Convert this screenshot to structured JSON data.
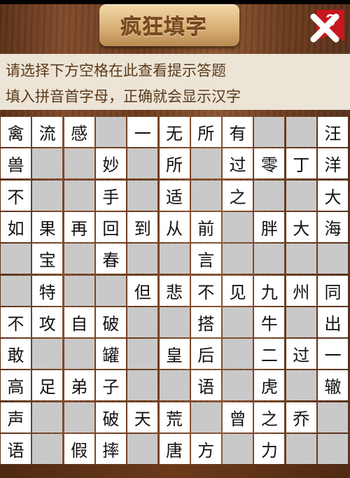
{
  "header": {
    "title": "疯狂填字",
    "level": "3",
    "close_icon": "close-x-icon"
  },
  "hint_panel": {
    "line1": "请选择下方空格在此查看提示答题",
    "line2": "填入拼音首字母，正确就会显示汉字"
  },
  "colors": {
    "background_wood": "#6b3d1c",
    "hint_panel": "#ece4d6",
    "hint_text": "#5a3a1c",
    "cell_letter": "#ffffff",
    "cell_blank": "#c9c9c9",
    "ribbon": "#c8161e"
  },
  "grid": {
    "rows": 11,
    "cols": 11,
    "cells": [
      [
        "禽",
        "流",
        "感",
        "#",
        "一",
        "无",
        "所",
        "有",
        "#",
        "#",
        "汪"
      ],
      [
        "兽",
        "#",
        "#",
        "妙",
        "#",
        "所",
        "#",
        "过",
        "零",
        "丁",
        "洋"
      ],
      [
        "不",
        "#",
        "#",
        "手",
        "#",
        "适",
        "#",
        "之",
        "#",
        "#",
        "大"
      ],
      [
        "如",
        "果",
        "再",
        "回",
        "到",
        "从",
        "前",
        "#",
        "胖",
        "大",
        "海"
      ],
      [
        "#",
        "宝",
        "#",
        "春",
        "#",
        "#",
        "言",
        "#",
        "#",
        "#",
        "#"
      ],
      [
        "#",
        "特",
        "#",
        "#",
        "但",
        "悲",
        "不",
        "见",
        "九",
        "州",
        "同"
      ],
      [
        "不",
        "攻",
        "自",
        "破",
        "#",
        "#",
        "搭",
        "#",
        "牛",
        "#",
        "出"
      ],
      [
        "敢",
        "#",
        "#",
        "罐",
        "#",
        "皇",
        "后",
        "#",
        "二",
        "过",
        "一"
      ],
      [
        "高",
        "足",
        "弟",
        "子",
        "#",
        "#",
        "语",
        "#",
        "虎",
        "#",
        "辙"
      ],
      [
        "声",
        "#",
        "#",
        "破",
        "天",
        "荒",
        "#",
        "曾",
        "之",
        "乔",
        "#"
      ],
      [
        "语",
        "#",
        "假",
        "摔",
        "#",
        "唐",
        "方",
        "#",
        "力",
        "#",
        "#"
      ]
    ]
  }
}
